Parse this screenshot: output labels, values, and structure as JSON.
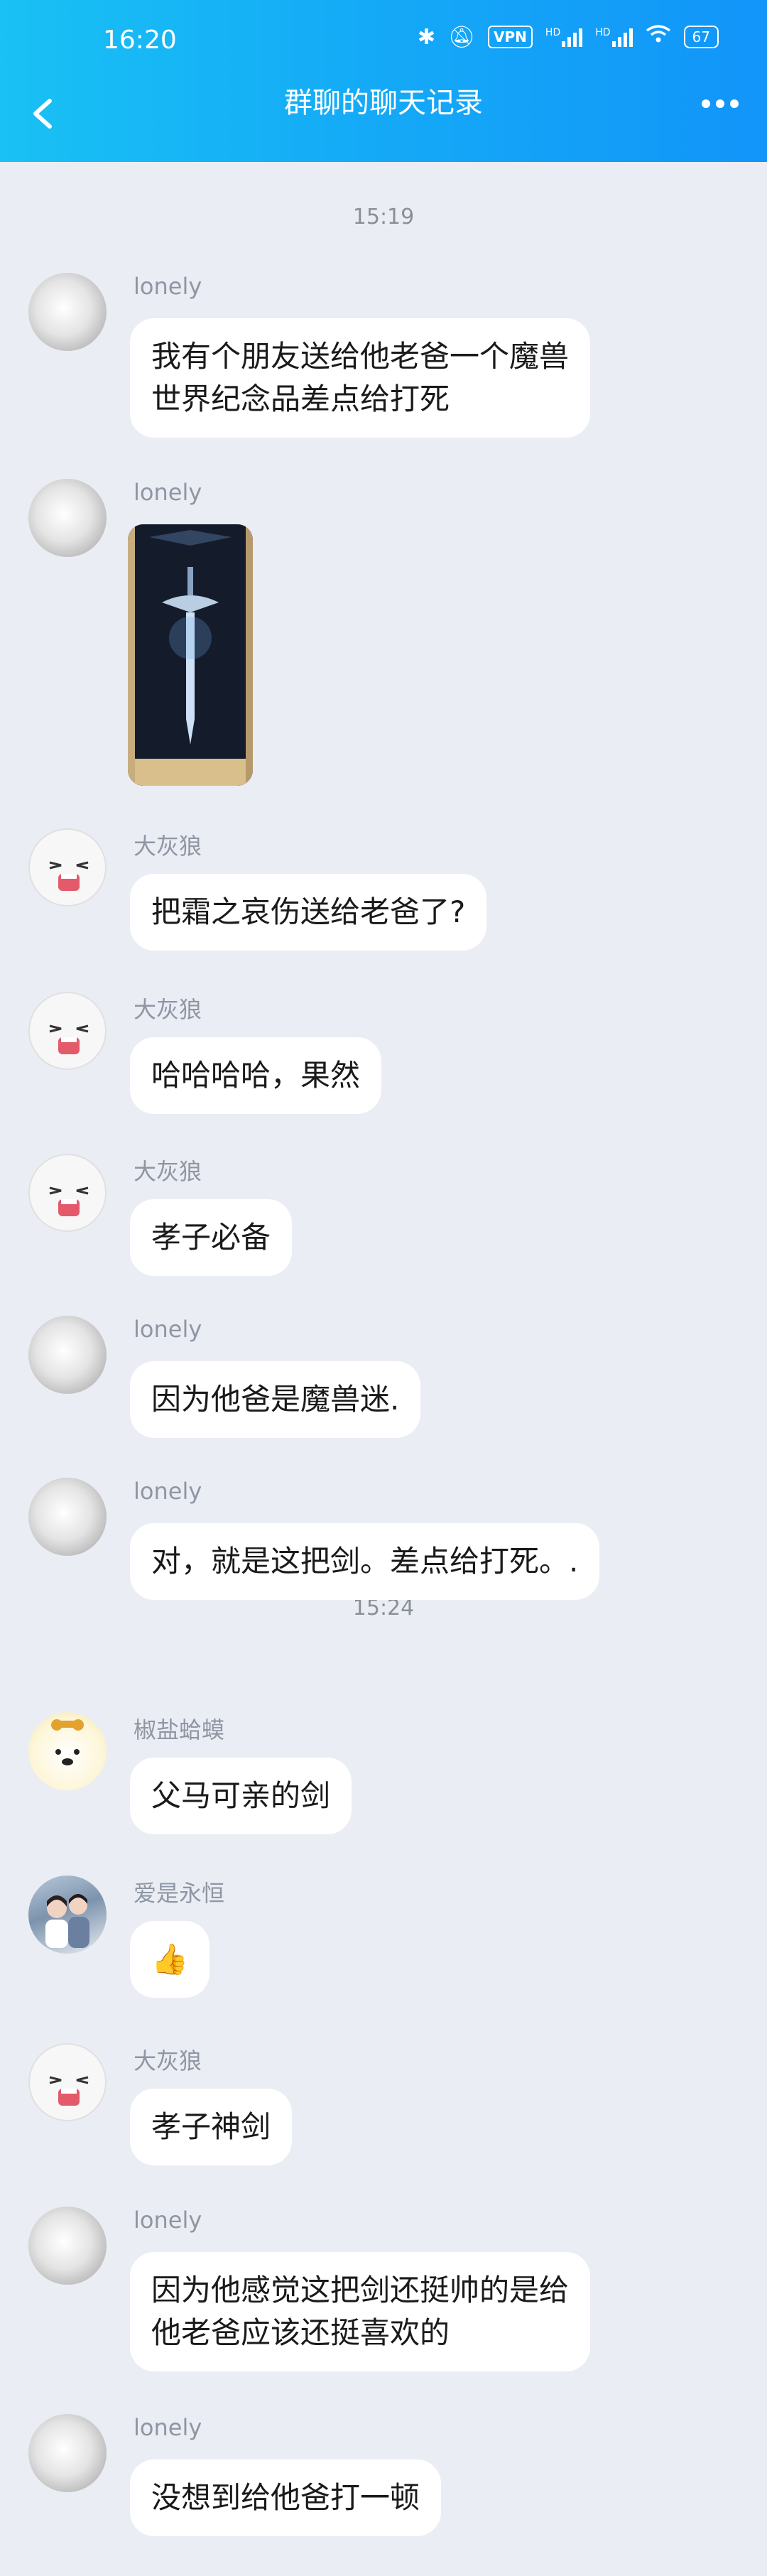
{
  "status_bar": {
    "time": "16:20",
    "vpn": "VPN",
    "hd1": "HD",
    "hd2": "HD",
    "battery": "67"
  },
  "nav": {
    "title": "群聊的聊天记录"
  },
  "timestamps": [
    "15:19",
    "15:24"
  ],
  "messages": [
    {
      "sender": "lonely",
      "text": "我有个朋友送给他老爸一个魔兽\n世界纪念品差点给打死",
      "avatar": "lonely-avatar"
    },
    {
      "sender": "lonely",
      "text": "",
      "avatar": "lonely-avatar",
      "image": "frostmourne-sword-box-photo"
    },
    {
      "sender": "大灰狼",
      "text": "把霜之哀伤送给老爸了?",
      "avatar": "crying-face-avatar"
    },
    {
      "sender": "大灰狼",
      "text": "哈哈哈哈，果然",
      "avatar": "crying-face-avatar"
    },
    {
      "sender": "大灰狼",
      "text": "孝子必备",
      "avatar": "crying-face-avatar"
    },
    {
      "sender": "lonely",
      "text": "因为他爸是魔兽迷.",
      "avatar": "lonely-avatar"
    },
    {
      "sender": "lonely",
      "text": "对，就是这把剑。差点给打死。.",
      "avatar": "lonely-avatar"
    },
    {
      "sender": "椒盐蛤蟆",
      "text": "父马可亲的剑",
      "avatar": "dog-avatar"
    },
    {
      "sender": "爱是永恒",
      "text": "👍",
      "avatar": "couple-photo-avatar"
    },
    {
      "sender": "大灰狼",
      "text": "孝子神剑",
      "avatar": "crying-face-avatar"
    },
    {
      "sender": "lonely",
      "text": "因为他感觉这把剑还挺帅的是给\n他老爸应该还挺喜欢的",
      "avatar": "lonely-avatar"
    },
    {
      "sender": "lonely",
      "text": "没想到给他爸打一顿",
      "avatar": "lonely-avatar"
    }
  ],
  "colors": {
    "header_start": "#19c1f4",
    "header_end": "#1295f9",
    "background": "#eaedf4",
    "bubble": "#ffffff"
  }
}
